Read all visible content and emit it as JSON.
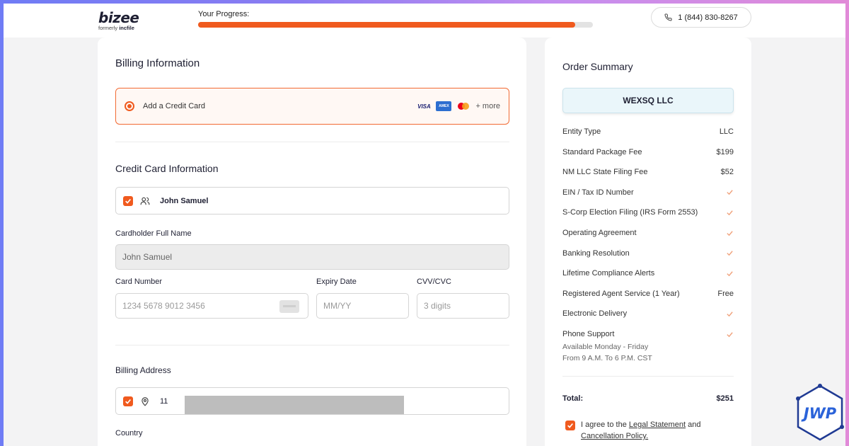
{
  "header": {
    "logo": "bizee",
    "logo_formerly": "formerly",
    "logo_formerly_brand": "incfile",
    "progress_label": "Your Progress:",
    "progress_fraction": 0.955,
    "phone": "1 (844) 830-8267"
  },
  "billing": {
    "title": "Billing Information",
    "payment_option_label": "Add a Credit Card",
    "card_brands": [
      "VISA",
      "AMEX",
      "mastercard"
    ],
    "more_label": "+ more",
    "card_section_title": "Credit Card Information",
    "saved_cardholder": "John Samuel",
    "cardholder_label": "Cardholder Full Name",
    "cardholder_value": "John Samuel",
    "card_number_label": "Card Number",
    "card_number_placeholder": "1234 5678 9012 3456",
    "expiry_label": "Expiry Date",
    "expiry_placeholder": "MM/YY",
    "cvv_label": "CVV/CVC",
    "cvv_placeholder": "3 digits",
    "address_title": "Billing Address",
    "address_prefix": "11",
    "country_label": "Country"
  },
  "summary": {
    "title": "Order Summary",
    "company": "WEXSQ LLC",
    "rows": [
      {
        "label": "Entity Type",
        "value": "LLC"
      },
      {
        "label": "Standard Package Fee",
        "value": "$199"
      },
      {
        "label": "NM LLC State Filing Fee",
        "value": "$52"
      },
      {
        "label": "EIN / Tax ID Number",
        "value": "check"
      },
      {
        "label": "S-Corp Election Filing (IRS Form 2553)",
        "value": "check"
      },
      {
        "label": "Operating Agreement",
        "value": "check"
      },
      {
        "label": "Banking Resolution",
        "value": "check"
      },
      {
        "label": "Lifetime Compliance Alerts",
        "value": "check"
      },
      {
        "label": "Registered Agent Service (1 Year)",
        "value": "Free"
      },
      {
        "label": "Electronic Delivery",
        "value": "check"
      },
      {
        "label": "Phone Support",
        "value": "check"
      }
    ],
    "availability_line1": "Available Monday - Friday",
    "availability_line2": "From 9 A.M. To 6 P.M. CST",
    "total_label": "Total:",
    "total_value": "$251",
    "agree_prefix": "I agree to the",
    "agree_link1": "Legal Statement",
    "agree_mid": "and",
    "agree_link2": "Cancellation Policy."
  },
  "watermark": "JWP",
  "colors": {
    "accent": "#f05a1e",
    "check": "#f0a27c",
    "company_bg": "#eaf6fa"
  }
}
